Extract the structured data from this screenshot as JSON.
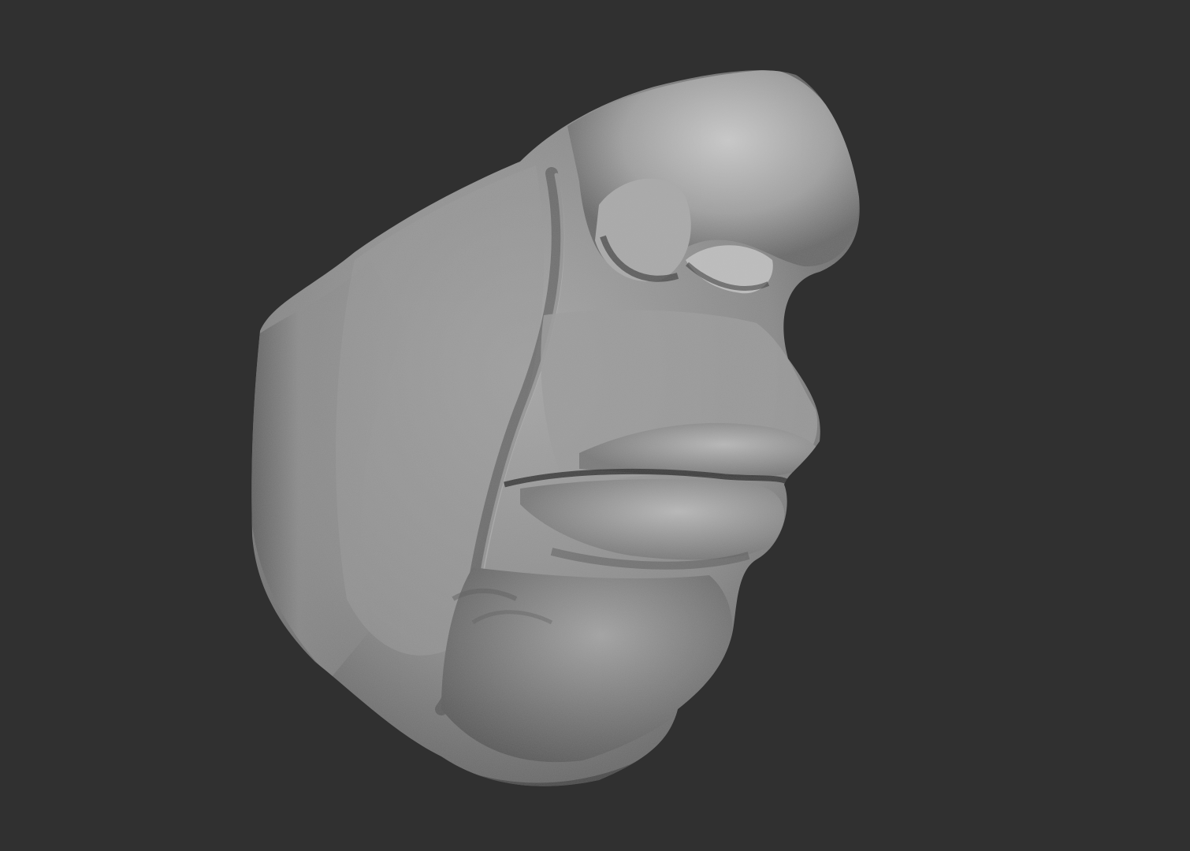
{
  "viewport": {
    "background_color": "#303030",
    "subject": "face-sculpt-mesh",
    "material_colors": {
      "base": "#8e8e8e",
      "highlight": "#c8c8c8",
      "shadow": "#3a3a3a"
    }
  }
}
